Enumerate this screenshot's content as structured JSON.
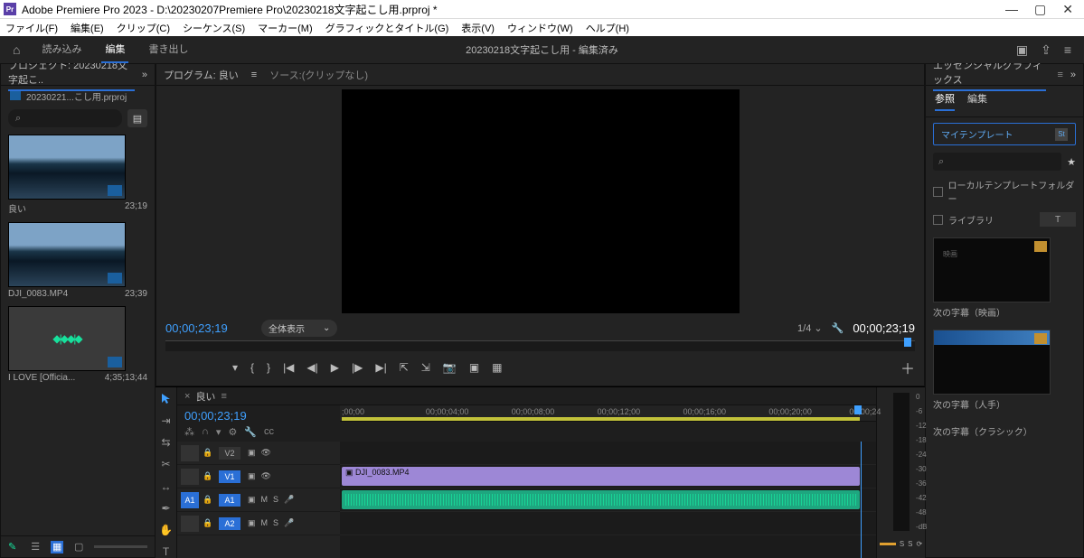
{
  "titlebar": {
    "app_abbrev": "Pr",
    "title": "Adobe Premiere Pro 2023 - D:\\20230207Premiere Pro\\20230218文字起こし用.prproj *"
  },
  "menu": [
    "ファイル(F)",
    "編集(E)",
    "クリップ(C)",
    "シーケンス(S)",
    "マーカー(M)",
    "グラフィックとタイトル(G)",
    "表示(V)",
    "ウィンドウ(W)",
    "ヘルプ(H)"
  ],
  "workspace": {
    "tabs": [
      "読み込み",
      "編集",
      "書き出し"
    ],
    "active": 1,
    "center": "20230218文字起こし用 - 編集済み"
  },
  "project": {
    "panel_title": "プロジェクト: 20230218文字起こ..",
    "bin_label": "20230221...こし用.prproj",
    "search_placeholder": "",
    "assets": [
      {
        "name": "良い",
        "dur": "23;19",
        "kind": "video"
      },
      {
        "name": "DJI_0083.MP4",
        "dur": "23;39",
        "kind": "video"
      },
      {
        "name": "I LOVE [Officia...",
        "dur": "4;35;13;44",
        "kind": "audio"
      }
    ]
  },
  "program": {
    "tab_label": "プログラム: 良い",
    "source_label": "ソース:(クリップなし)",
    "tc_left": "00;00;23;19",
    "zoom_label": "全体表示",
    "ratio": "1/4",
    "tc_right": "00;00;23;19"
  },
  "timeline": {
    "tab": "良い",
    "tc": "00;00;23;19",
    "ruler_marks": [
      ";00;00",
      "00;00;04;00",
      "00;00;08;00",
      "00;00;12;00",
      "00;00;16;00",
      "00;00;20;00",
      "00;00;24"
    ],
    "tracks": {
      "v2": {
        "name": "V2"
      },
      "v1": {
        "name": "V1",
        "clip": "DJI_0083.MP4"
      },
      "a1": {
        "src": "A1",
        "name": "A1"
      },
      "a2": {
        "name": "A2"
      }
    },
    "tool_labels": [
      "M",
      "S"
    ],
    "meter_scale": [
      "0",
      "-6",
      "-12",
      "-18",
      "-24",
      "-30",
      "-36",
      "-42",
      "-48",
      "-dB"
    ],
    "meter_bottom": [
      "S",
      "S"
    ]
  },
  "eg": {
    "panel_title": "エッセンシャルグラフィックス",
    "tabs": [
      "参照",
      "編集"
    ],
    "template_btn": "マイテンプレート",
    "check1": "ローカルテンプレートフォルダー",
    "check2": "ライブラリ",
    "check2_box": "T",
    "st_label": "St",
    "presets": [
      {
        "label": "次の字幕（映画）",
        "variant": "plain",
        "txt": "映画"
      },
      {
        "label": "次の字幕（人手）",
        "variant": "blue"
      },
      {
        "label": "次の字幕（クラシック）",
        "variant": "none"
      }
    ]
  }
}
